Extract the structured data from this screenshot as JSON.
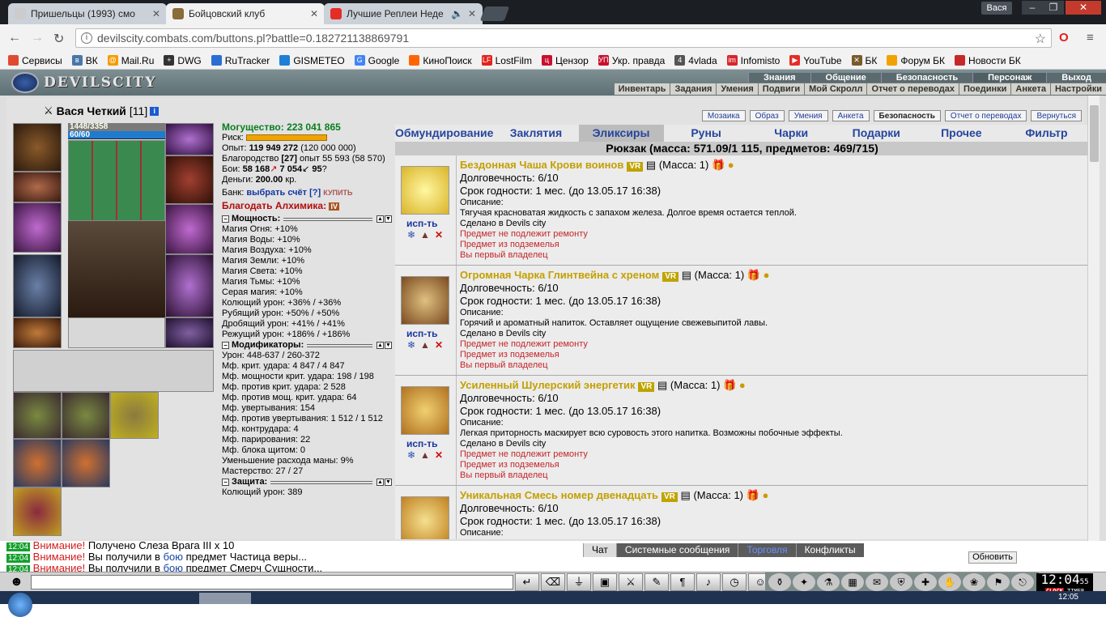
{
  "browser": {
    "tabs": [
      {
        "title": "Пришельцы (1993) смо",
        "active": false,
        "icon_color": "#cccccc"
      },
      {
        "title": "Бойцовский клуб",
        "active": true,
        "icon_color": "#8a6b3a"
      },
      {
        "title": "Лучшие Реплеи Неде",
        "active": false,
        "icon_color": "#e52d27"
      }
    ],
    "user": "Вася",
    "url": "devilscity.combats.com/buttons.pl?battle=0.182721138869791",
    "bookmarks": [
      {
        "label": "Сервисы",
        "color": "#e04a2f"
      },
      {
        "label": "ВК",
        "color": "#4a76a8"
      },
      {
        "label": "Mail.Ru",
        "color": "#f59c00"
      },
      {
        "label": "DWG",
        "color": "#333333"
      },
      {
        "label": "RuTracker",
        "color": "#2a6ed2"
      },
      {
        "label": "GISMETEO",
        "color": "#1e7fd6"
      },
      {
        "label": "Google",
        "color": "#4285f4"
      },
      {
        "label": "КиноПоиск",
        "color": "#ff6600"
      },
      {
        "label": "LostFilm",
        "color": "#e2231a"
      },
      {
        "label": "Цензор",
        "color": "#c8102e"
      },
      {
        "label": "Укр. правда",
        "color": "#c8102e"
      },
      {
        "label": "4vlada",
        "color": "#555555"
      },
      {
        "label": "Infomisto",
        "color": "#d7262b"
      },
      {
        "label": "YouTube",
        "color": "#e52d27"
      },
      {
        "label": "БК",
        "color": "#7a5a2a"
      },
      {
        "label": "Форум БК",
        "color": "#f2a200"
      },
      {
        "label": "Новости БК",
        "color": "#c62828"
      }
    ]
  },
  "game": {
    "logo": "DEVILSCITY",
    "topmenu": [
      "Знания",
      "Общение",
      "Безопасность",
      "Персонаж",
      "Выход"
    ],
    "submenu": [
      "Инвентарь",
      "Задания",
      "Умения",
      "Подвиги",
      "Мой Скролл",
      "Отчет о переводах",
      "Поединки",
      "Анкета",
      "Настройки"
    ],
    "char": {
      "name": "Вася Четкий",
      "level": "[11]",
      "hp": "1448/3358",
      "mp": "60/60"
    },
    "stats": {
      "power": "Могущество: 223 041 865",
      "risk": "Риск:",
      "exp_label": "Опыт:",
      "exp": "119 949 272",
      "exp_extra": "(120 000 000)",
      "nobility": "Благородство",
      "nobility_val": "[27]",
      "nobility_rest": "опыт 55 593 (58 570)",
      "fights_label": "Бои:",
      "wins": "58 168",
      "losses": "7 054",
      "draws": "95",
      "money_label": "Деньги:",
      "money": "200.00",
      "money_unit": "кр.",
      "bank_label": "Банк:",
      "bank_link": "выбрать счёт",
      "bank_q": "[?]",
      "bank_buy": "КУПИТЬ",
      "blessing": "Благодать Алхимика:",
      "sec_power": "Мощность:",
      "power_list": [
        "Магия Огня: +10%",
        "Магия Воды: +10%",
        "Магия Воздуха: +10%",
        "Магия Земли: +10%",
        "Магия Света: +10%",
        "Магия Тьмы: +10%",
        "Серая магия: +10%",
        "Колющий урон: +36% / +36%",
        "Рубящий урон: +50% / +50%",
        "Дробящий урон: +41% / +41%",
        "Режущий урон: +186% / +186%"
      ],
      "sec_mods": "Модификаторы:",
      "mods_list": [
        "Урон: 448-637 / 260-372",
        "Мф. крит. удара: 4 847 / 4 847",
        "Мф. мощности крит. удара: 198 / 198",
        "Мф. против крит. удара: 2 528",
        "Мф. против мощ. крит. удара: 64",
        "Мф. увертывания: 154",
        "Мф. против увертывания: 1 512 / 1 512",
        "Мф. контрудара: 4",
        "Мф. парирования: 22",
        "Мф. блока щитом: 0",
        "Уменьшение расхода маны: 9%",
        "Мастерство: 27 / 27"
      ],
      "sec_def": "Защита:",
      "def_list": [
        "Колющий урон: 389"
      ]
    },
    "right_buttons": [
      "Мозаика",
      "Образ",
      "Умения",
      "Анкета",
      "Безопасность",
      "Отчет о переводах",
      "Вернуться"
    ],
    "categories": [
      "Обмундирование",
      "Заклятия",
      "Эликсиры",
      "Руны",
      "Чарки",
      "Подарки",
      "Прочее",
      "Фильтр"
    ],
    "active_category": "Эликсиры",
    "backpack": "Рюкзак (масса: 571.09/1 115, предметов: 469/715)",
    "items": [
      {
        "name": "Бездонная Чаша Крови воинов",
        "mass": "(Масса: 1)",
        "dur": "Долговечность: 6/10",
        "exp": "Срок годности: 1 мес. (до 13.05.17 16:38)",
        "desc_label": "Описание:",
        "desc": "Тягучая красноватая жидкость с запахом железа. Долгое время остается теплой.",
        "made": "Сделано в Devils city",
        "r1": "Предмет не подлежит ремонту",
        "r2": "Предмет из подземелья",
        "r3": "Вы первый владелец",
        "use": "исп-ть"
      },
      {
        "name": "Огромная Чарка Глинтвейна с хреном",
        "mass": "(Масса: 1)",
        "dur": "Долговечность: 6/10",
        "exp": "Срок годности: 1 мес. (до 13.05.17 16:38)",
        "desc_label": "Описание:",
        "desc": "Горячий и ароматный напиток. Оставляет ощущение свежевыпитой лавы.",
        "made": "Сделано в Devils city",
        "r1": "Предмет не подлежит ремонту",
        "r2": "Предмет из подземелья",
        "r3": "Вы первый владелец",
        "use": "исп-ть"
      },
      {
        "name": "Усиленный Шулерский энергетик",
        "mass": "(Масса: 1)",
        "dur": "Долговечность: 6/10",
        "exp": "Срок годности: 1 мес. (до 13.05.17 16:38)",
        "desc_label": "Описание:",
        "desc": "Легкая приторность маскирует всю суровость этого напитка. Возможны побочные эффекты.",
        "made": "Сделано в Devils city",
        "r1": "Предмет не подлежит ремонту",
        "r2": "Предмет из подземелья",
        "r3": "Вы первый владелец",
        "use": "исп-ть"
      },
      {
        "name": "Уникальная Смесь номер двенадцать",
        "mass": "(Масса: 1)",
        "dur": "Долговечность: 6/10",
        "exp": "Срок годности: 1 мес. (до 13.05.17 16:38)",
        "desc_label": "Описание:",
        "desc": "",
        "made": "",
        "r1": "",
        "r2": "",
        "r3": "",
        "use": ""
      }
    ],
    "vr": "VR"
  },
  "chat": {
    "lines": [
      {
        "time": "12:04",
        "warn": "Внимание!",
        "text": "Получено Слеза Врага III x 10"
      },
      {
        "time": "12:04",
        "warn": "Внимание!",
        "text_a": "Вы получили в",
        "link": "бою",
        "text_b": "предмет Частица веры..."
      },
      {
        "time": "12:04",
        "warn": "Внимание!",
        "text_a": "Вы получили в",
        "link": "бою",
        "text_b": "предмет Смерч Сущности..."
      }
    ],
    "tabs": [
      "Чат",
      "Системные сообщения",
      "Торговля",
      "Конфликты"
    ],
    "refresh": "Обновить"
  },
  "clock": {
    "time": "12:04",
    "sec": "55",
    "label_a": "CLOCK",
    "label_b": "TIMER"
  },
  "os_time": "12:05"
}
